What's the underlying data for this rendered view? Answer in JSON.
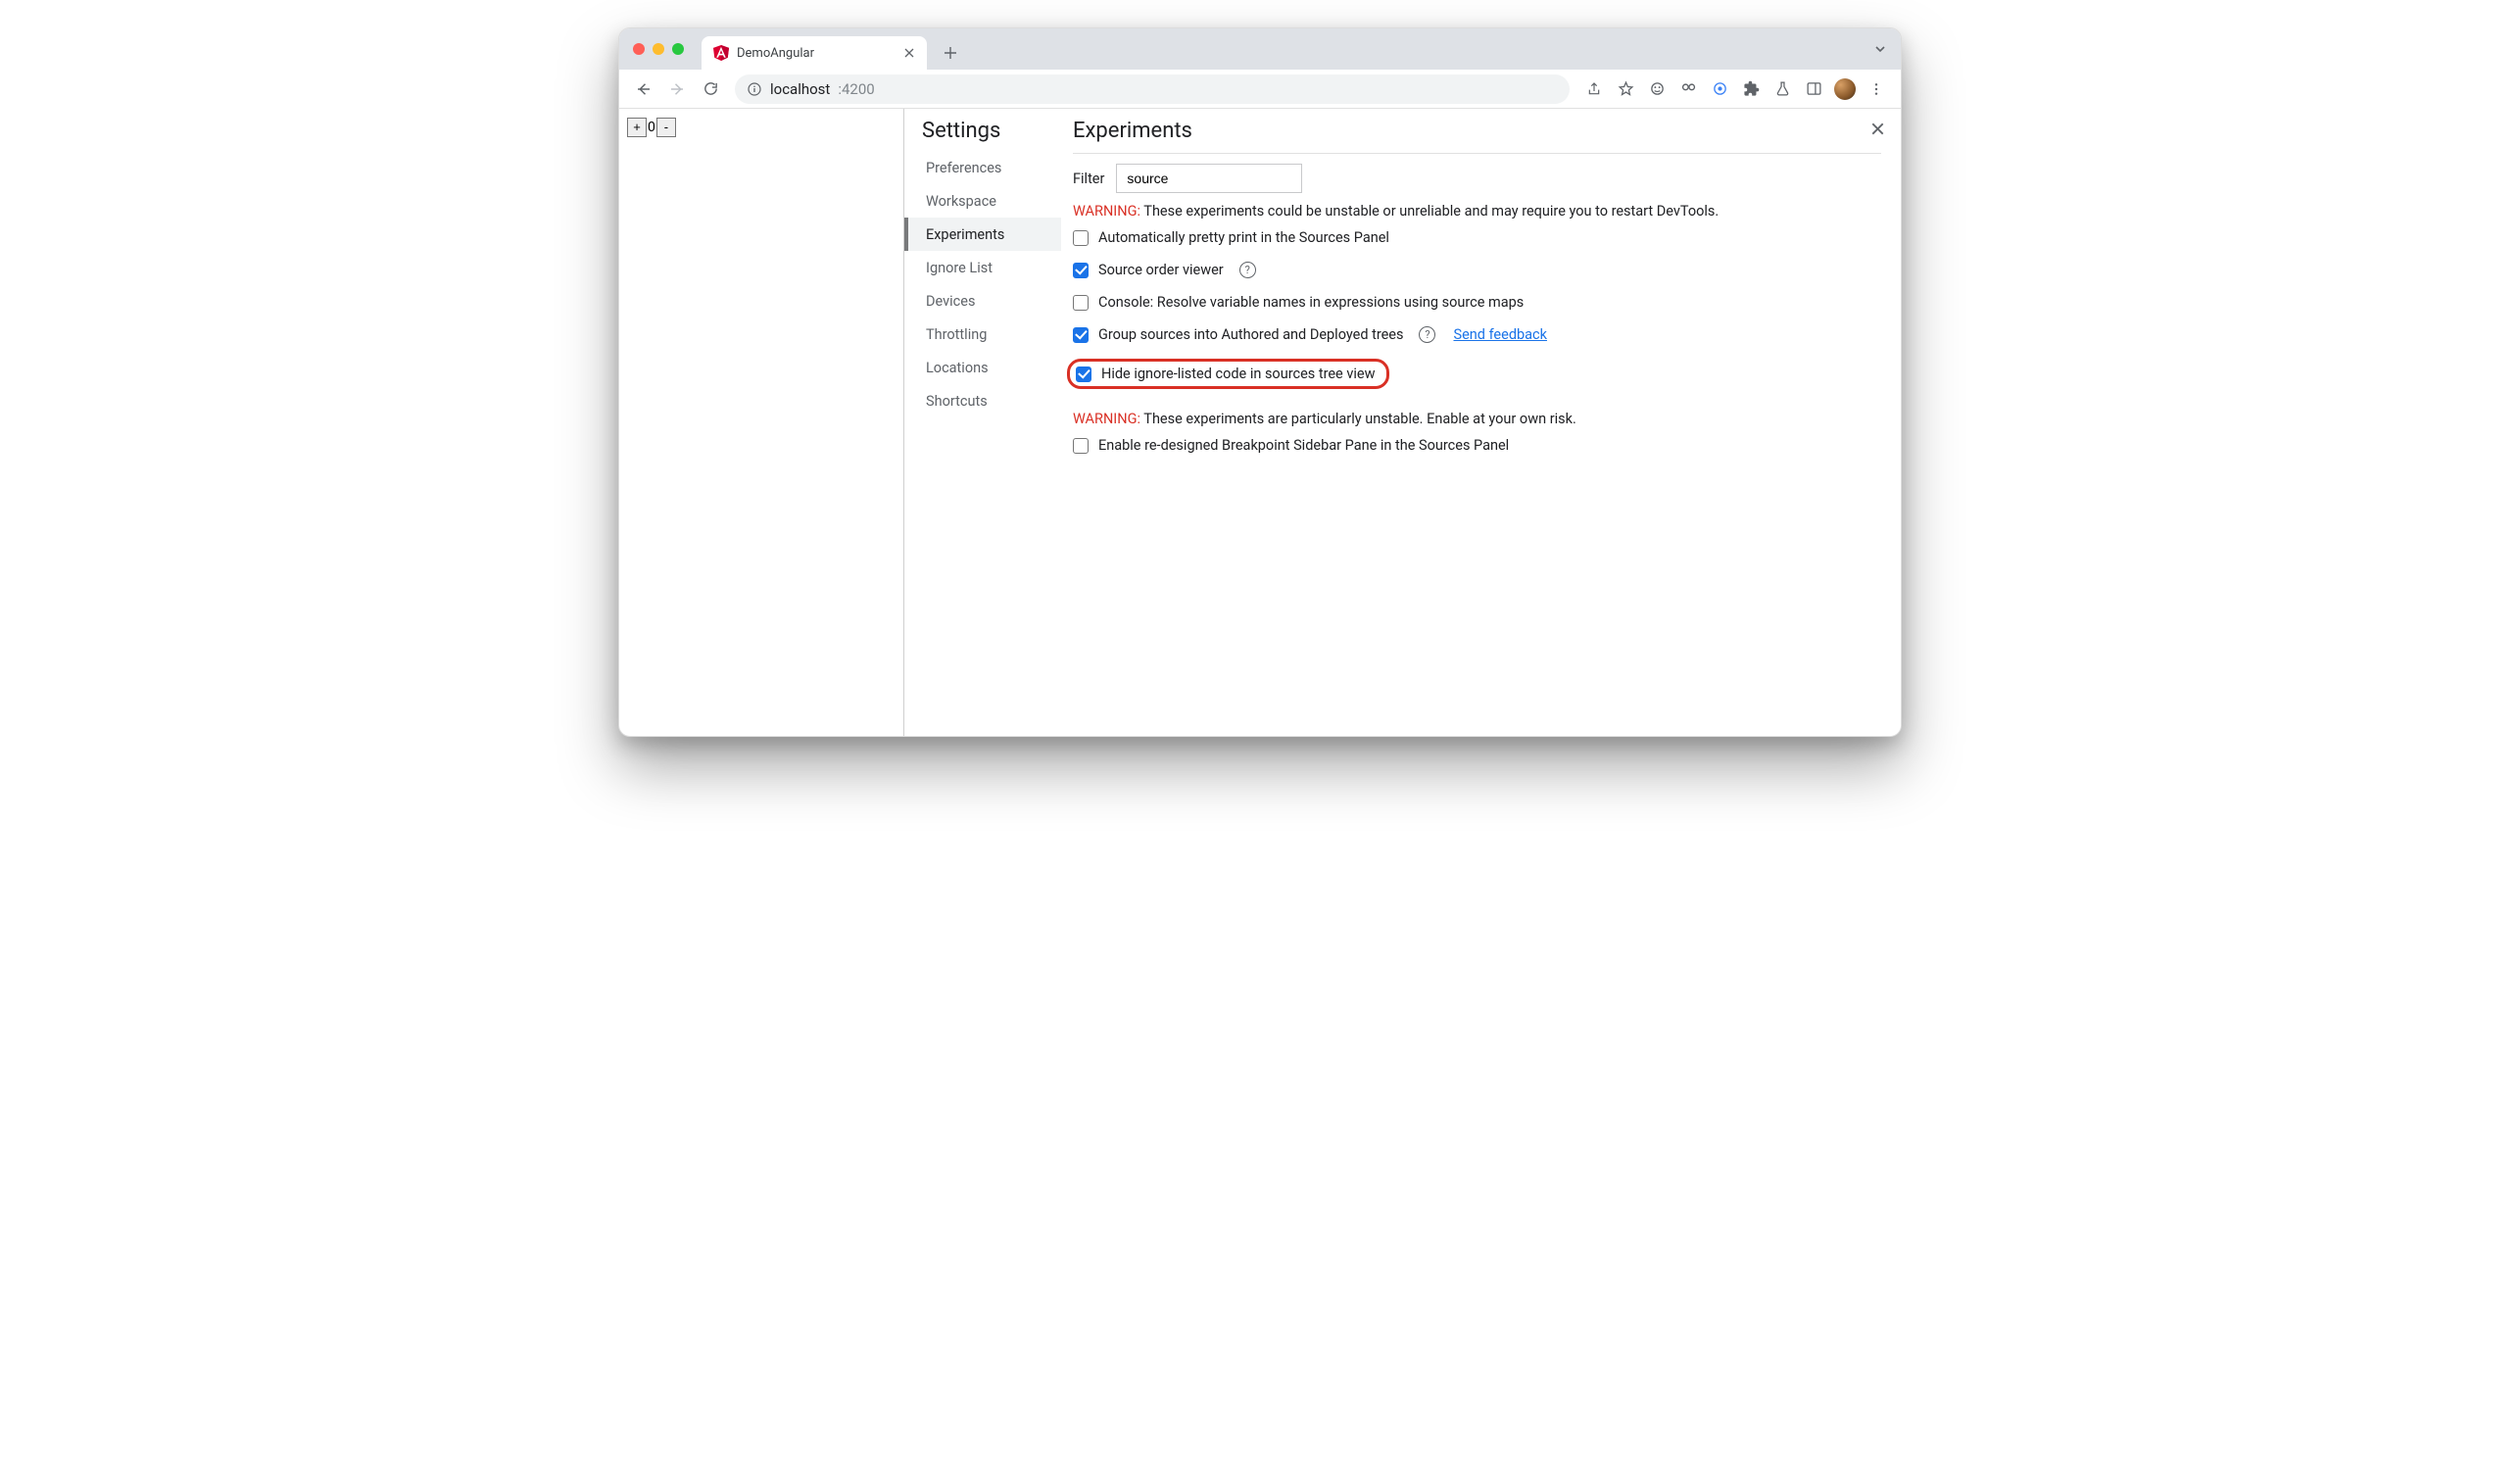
{
  "browser": {
    "tab_title": "DemoAngular",
    "url_host": "localhost",
    "url_port": ":4200"
  },
  "page": {
    "counter_value": "0"
  },
  "devtools": {
    "settings_title": "Settings",
    "sidebar": {
      "items": [
        {
          "label": "Preferences",
          "active": false
        },
        {
          "label": "Workspace",
          "active": false
        },
        {
          "label": "Experiments",
          "active": true
        },
        {
          "label": "Ignore List",
          "active": false
        },
        {
          "label": "Devices",
          "active": false
        },
        {
          "label": "Throttling",
          "active": false
        },
        {
          "label": "Locations",
          "active": false
        },
        {
          "label": "Shortcuts",
          "active": false
        }
      ]
    },
    "main": {
      "heading": "Experiments",
      "filter_label": "Filter",
      "filter_value": "source",
      "warning1_label": "WARNING:",
      "warning1_text": " These experiments could be unstable or unreliable and may require you to restart DevTools.",
      "experiments": [
        {
          "label": "Automatically pretty print in the Sources Panel",
          "checked": false,
          "help": false,
          "link": null,
          "highlight": false
        },
        {
          "label": "Source order viewer",
          "checked": true,
          "help": true,
          "link": null,
          "highlight": false
        },
        {
          "label": "Console: Resolve variable names in expressions using source maps",
          "checked": false,
          "help": false,
          "link": null,
          "highlight": false
        },
        {
          "label": "Group sources into Authored and Deployed trees",
          "checked": true,
          "help": true,
          "link": "Send feedback",
          "highlight": false
        },
        {
          "label": "Hide ignore-listed code in sources tree view",
          "checked": true,
          "help": false,
          "link": null,
          "highlight": true
        }
      ],
      "warning2_label": "WARNING:",
      "warning2_text": " These experiments are particularly unstable. Enable at your own risk.",
      "experiments_unstable": [
        {
          "label": "Enable re-designed Breakpoint Sidebar Pane in the Sources Panel",
          "checked": false,
          "help": false,
          "link": null,
          "highlight": false
        }
      ]
    }
  }
}
